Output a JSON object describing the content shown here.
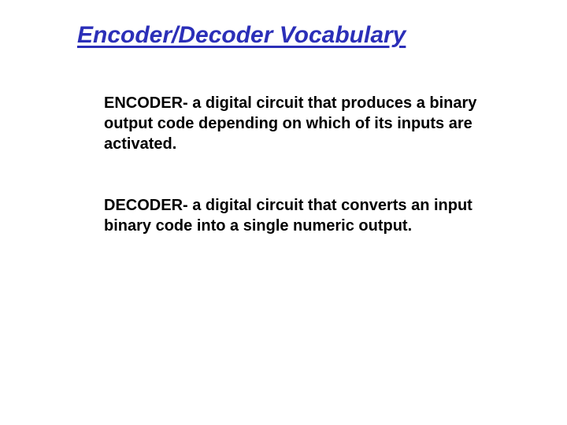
{
  "slide": {
    "title": "Encoder/Decoder Vocabulary",
    "definitions": [
      "ENCODER- a digital circuit that produces a binary output code depending on which of its inputs are activated.",
      "DECODER- a digital circuit that converts an input binary code into a single numeric output."
    ]
  }
}
